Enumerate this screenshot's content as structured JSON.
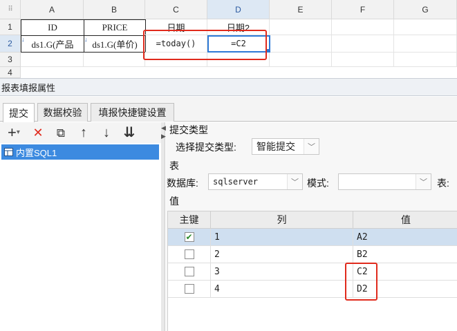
{
  "sheet": {
    "corner_icon": "grid-dots-icon",
    "columns": [
      "A",
      "B",
      "C",
      "D",
      "E",
      "F",
      "G"
    ],
    "rows": [
      "1",
      "2",
      "3",
      "4"
    ],
    "row1": [
      "ID",
      "PRICE",
      "日期",
      "日期2"
    ],
    "row2": [
      "ds1.G(产品",
      "ds1.G(单价)",
      "=today()",
      "=C2"
    ],
    "accent": "#2d79d6",
    "highlight_color": "#e02a1c"
  },
  "panel": {
    "title": "报表填报属性",
    "tabs": [
      "提交",
      "数据校验",
      "填报快捷键设置"
    ],
    "toolbar": {
      "add": "+",
      "add_dropdown": "▾",
      "delete": "✕",
      "copy": "⧉",
      "up": "↑",
      "down": "↓",
      "sort": "⇊"
    },
    "tree_item": "内置SQL1",
    "submit_type_section": "提交类型",
    "choose_submit_type_label": "选择提交类型:",
    "submit_type_value": "智能提交",
    "table_section": "表",
    "database_label": "数据库:",
    "database_value": "sqlserver",
    "schema_label": "模式:",
    "schema_value": "",
    "table_label": "表:",
    "value_section": "值",
    "grid": {
      "headers": [
        "主键",
        "列",
        "值"
      ],
      "rows": [
        {
          "checked": true,
          "col": "1",
          "val": "A2"
        },
        {
          "checked": false,
          "col": "2",
          "val": "B2"
        },
        {
          "checked": false,
          "col": "3",
          "val": "C2"
        },
        {
          "checked": false,
          "col": "4",
          "val": "D2"
        }
      ]
    }
  }
}
